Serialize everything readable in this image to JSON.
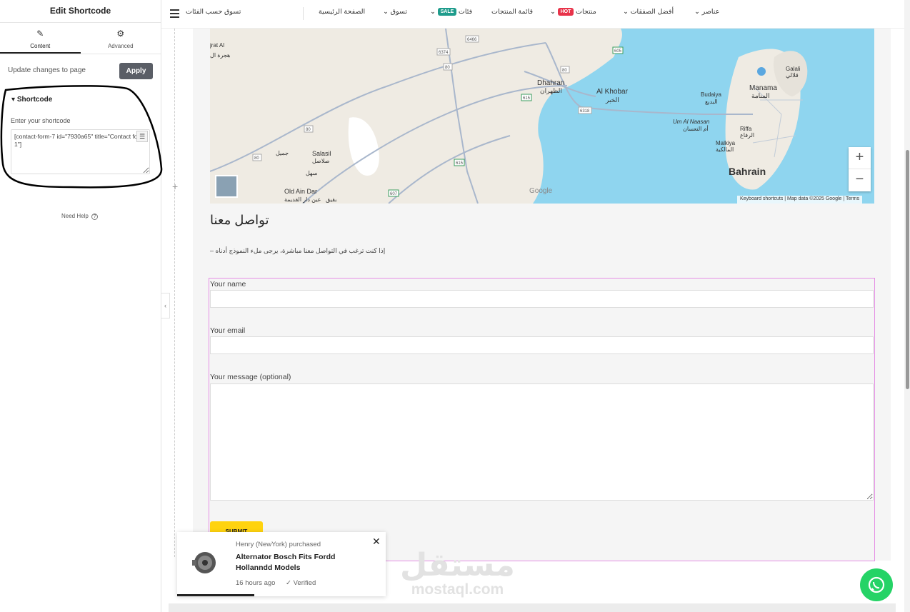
{
  "panel": {
    "title": "Edit Shortcode",
    "tabs": [
      {
        "label": "Content",
        "icon": "pencil-icon"
      },
      {
        "label": "Advanced",
        "icon": "gear-icon"
      }
    ],
    "update_label": "Update changes to page",
    "apply_label": "Apply",
    "section_title": "Shortcode",
    "shortcode_label": "Enter your shortcode",
    "shortcode_value": "[contact-form-7 id=\"7930a65\" title=\"Contact form 1\"]",
    "help_label": "Need Help"
  },
  "nav": {
    "categories": "تسوق حسب الفئات",
    "items": [
      {
        "label": "الصفحة الرئيسية"
      },
      {
        "label": "تسوق"
      },
      {
        "label": "فئات",
        "badge": "SALE",
        "badge_color": "#1f9c8c"
      },
      {
        "label": "قائمة المنتجات"
      },
      {
        "label": "منتجات",
        "badge": "HOT",
        "badge_color": "#e8334a"
      },
      {
        "label": "أفضل الصفقات"
      },
      {
        "label": "عناصر"
      }
    ]
  },
  "map": {
    "labels": {
      "dhahran": "Dhahran",
      "dhahran_ar": "الظهران",
      "alkhobar": "Al Khobar",
      "alkhobar_ar": "الخبر",
      "manama": "Manama",
      "manama_ar": "المنامة",
      "bahrain": "Bahrain",
      "salasil": "Salasil",
      "salasil_ar": "صلاصل",
      "oldaindar": "Old Ain Dar",
      "oldaindar_ar": "عين دار القديمة",
      "budaiya": "Budaiya",
      "budaiya_ar": "البديع",
      "umalnaasan": "Um Al Naasan",
      "umalnaasan_ar": "أم النعسان",
      "riffa": "Riffa",
      "riffa_ar": "الرفاع",
      "malkiya": "Malkiya",
      "malkiya_ar": "المالكية",
      "galali": "Galali",
      "galali_ar": "قلالي",
      "jrat": "jrat Al",
      "jrat_ar": "هجرة ال",
      "sahl": "سهل",
      "jamil": "جميل",
      "bqayq": "بقيق"
    },
    "roads": [
      "6374",
      "6466",
      "80",
      "80",
      "615",
      "6318",
      "80",
      "80",
      "615",
      "607",
      "605"
    ],
    "google": "Google",
    "keyboard": "Keyboard shortcuts",
    "mapdata": "Map data ©2025 Google",
    "terms": "Terms",
    "zoom_in": "+",
    "zoom_out": "−"
  },
  "contact": {
    "title": "تواصل معنا",
    "description": "– إذا كنت ترغب في التواصل معنا مباشرة، يرجى ملء النموذج أدناه"
  },
  "form": {
    "name_label": "Your name",
    "email_label": "Your email",
    "message_label": "Your message (optional)",
    "submit_label": "SUBMIT"
  },
  "notification": {
    "buyer": "Henry (NewYork) purchased",
    "product": "Alternator Bosch Fits Fordd Hollanndd Models",
    "time": "16 hours ago",
    "verified": "Verified"
  },
  "watermark": {
    "arabic": "مستقل",
    "latin": "mostaql.com"
  }
}
